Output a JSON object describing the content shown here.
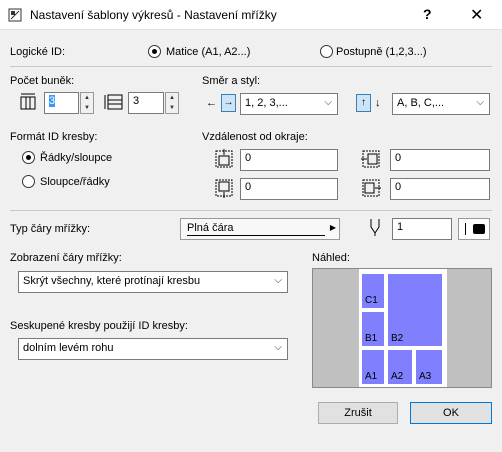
{
  "window": {
    "title": "Nastavení šablony výkresů - Nastavení mřížky",
    "help": "?",
    "close": "✕"
  },
  "logical_id": {
    "label": "Logické ID:",
    "option_matrix": "Matice (A1, A2...)",
    "option_sequential": "Postupně (1,2,3...)",
    "selected": "matrix"
  },
  "cells": {
    "label": "Počet buněk:",
    "columns_value": "3",
    "rows_value": "3"
  },
  "direction": {
    "label": "Směr a styl:",
    "h_style": "1, 2, 3,...",
    "v_style": "A, B, C,...",
    "left_arrow": "←",
    "right_arrow": "→",
    "up_arrow": "↑",
    "down_arrow": "↓"
  },
  "id_format": {
    "label": "Formát ID kresby:",
    "option_rows_cols": "Řádky/sloupce",
    "option_cols_rows": "Sloupce/řádky",
    "selected": "rows_cols"
  },
  "margins": {
    "label": "Vzdálenost od okraje:",
    "top": "0",
    "left": "0",
    "bottom": "0",
    "right": "0"
  },
  "line_type": {
    "label": "Typ čáry mřížky:",
    "value": "Plná čára",
    "pen": "1"
  },
  "line_display": {
    "label": "Zobrazení čáry mřížky:",
    "value": "Skrýt všechny, které protínají kresbu"
  },
  "grouped": {
    "label": "Seskupené kresby použijí ID kresby:",
    "value": "dolním levém rohu"
  },
  "preview": {
    "label": "Náhled:",
    "cells": {
      "c1": "C1",
      "b1": "B1",
      "b2": "B2",
      "a1": "A1",
      "a2": "A2",
      "a3": "A3"
    }
  },
  "buttons": {
    "cancel": "Zrušit",
    "ok": "OK"
  },
  "colors": {
    "preview_cell": "#8080ff",
    "preview_bg": "#c0c0c0",
    "accent": "#0078d7"
  }
}
